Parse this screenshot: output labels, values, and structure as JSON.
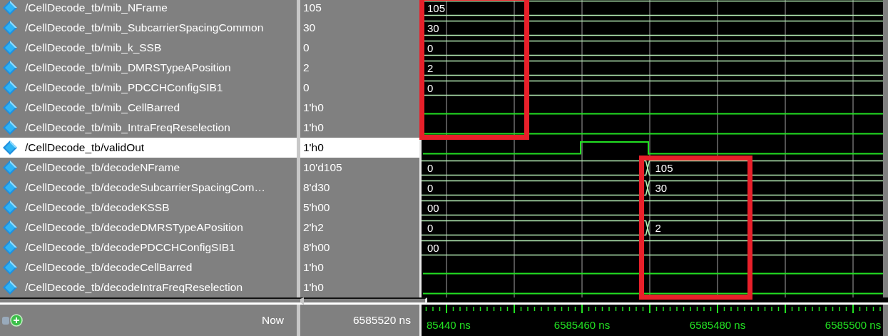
{
  "signals": [
    {
      "name": "/CellDecode_tb/mib_NFrame",
      "value": "105",
      "selected": false,
      "wave": {
        "kind": "bus",
        "segments": [
          {
            "label": "105"
          }
        ]
      }
    },
    {
      "name": "/CellDecode_tb/mib_SubcarrierSpacingCommon",
      "value": "30",
      "selected": false,
      "wave": {
        "kind": "bus",
        "segments": [
          {
            "label": "30"
          }
        ]
      }
    },
    {
      "name": "/CellDecode_tb/mib_k_SSB",
      "value": "0",
      "selected": false,
      "wave": {
        "kind": "bus",
        "segments": [
          {
            "label": "0"
          }
        ]
      }
    },
    {
      "name": "/CellDecode_tb/mib_DMRSTypeAPosition",
      "value": "2",
      "selected": false,
      "wave": {
        "kind": "bus",
        "segments": [
          {
            "label": "2"
          }
        ]
      }
    },
    {
      "name": "/CellDecode_tb/mib_PDCCHConfigSIB1",
      "value": "0",
      "selected": false,
      "wave": {
        "kind": "bus",
        "segments": [
          {
            "label": "0"
          }
        ]
      }
    },
    {
      "name": "/CellDecode_tb/mib_CellBarred",
      "value": "1'h0",
      "selected": false,
      "wave": {
        "kind": "bit",
        "segments": [
          {
            "high": false
          }
        ]
      }
    },
    {
      "name": "/CellDecode_tb/mib_IntraFreqReselection",
      "value": "1'h0",
      "selected": false,
      "wave": {
        "kind": "bit",
        "segments": [
          {
            "high": false
          }
        ]
      }
    },
    {
      "name": "/CellDecode_tb/validOut",
      "value": "1'h0",
      "selected": true,
      "wave": {
        "kind": "bit",
        "segments": [
          {
            "high": false
          },
          {
            "high": true
          },
          {
            "high": false
          }
        ]
      }
    },
    {
      "name": "/CellDecode_tb/decodeNFrame",
      "value": "10'd105",
      "selected": false,
      "wave": {
        "kind": "bus",
        "segments": [
          {
            "label": "0"
          },
          {
            "label": "105"
          }
        ]
      }
    },
    {
      "name": "/CellDecode_tb/decodeSubcarrierSpacingCom…",
      "value": "8'd30",
      "selected": false,
      "wave": {
        "kind": "bus",
        "segments": [
          {
            "label": "0"
          },
          {
            "label": "30"
          }
        ]
      }
    },
    {
      "name": "/CellDecode_tb/decodeKSSB",
      "value": "5'h00",
      "selected": false,
      "wave": {
        "kind": "bus",
        "segments": [
          {
            "label": "00"
          }
        ]
      }
    },
    {
      "name": "/CellDecode_tb/decodeDMRSTypeAPosition",
      "value": "2'h2",
      "selected": false,
      "wave": {
        "kind": "bus",
        "segments": [
          {
            "label": "0"
          },
          {
            "label": "2"
          }
        ]
      }
    },
    {
      "name": "/CellDecode_tb/decodePDCCHConfigSIB1",
      "value": "8'h00",
      "selected": false,
      "wave": {
        "kind": "bus",
        "segments": [
          {
            "label": "00"
          }
        ]
      }
    },
    {
      "name": "/CellDecode_tb/decodeCellBarred",
      "value": "1'h0",
      "selected": false,
      "wave": {
        "kind": "bit",
        "segments": [
          {
            "high": false
          }
        ]
      }
    },
    {
      "name": "/CellDecode_tb/decodeIntraFreqReselection",
      "value": "1'h0",
      "selected": false,
      "wave": {
        "kind": "bit",
        "segments": [
          {
            "high": false
          }
        ]
      }
    }
  ],
  "annotations": [
    {
      "kind": "box"
    },
    {
      "kind": "box"
    }
  ],
  "status": {
    "now_label": "Now",
    "now_value": "6585520 ns"
  },
  "timeline": {
    "labels": [
      "85440 ns",
      "6585460 ns",
      "6585480 ns",
      "6585500 ns"
    ]
  }
}
